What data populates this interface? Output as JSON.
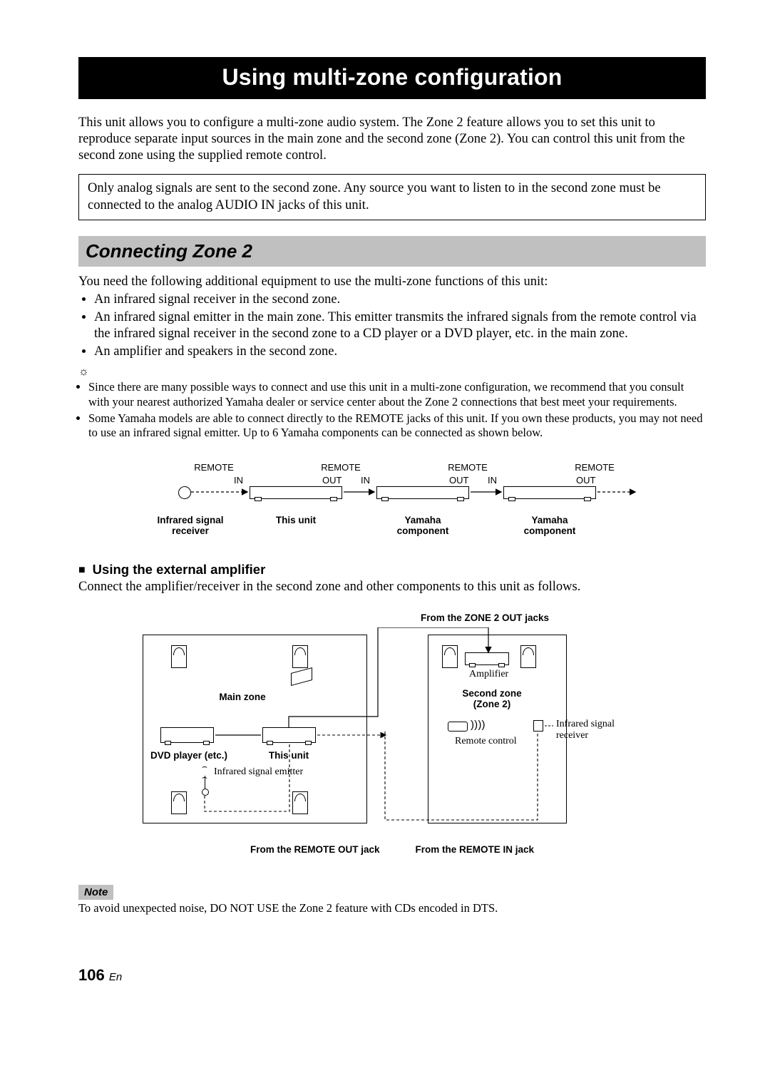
{
  "title": "Using multi-zone configuration",
  "intro": "This unit allows you to configure a multi-zone audio system. The Zone 2 feature allows you to set this unit to reproduce separate input sources in the main zone and the second zone (Zone 2). You can control this unit from the second zone using the supplied remote control.",
  "callout": "Only analog signals are sent to the second zone. Any source you want to listen to in the second zone must be connected to the analog AUDIO IN jacks of this unit.",
  "section_heading": "Connecting Zone 2",
  "equip_intro": "You need the following additional equipment to use the multi-zone functions of this unit:",
  "equip_bullets": [
    "An infrared signal receiver in the second zone.",
    "An infrared signal emitter in the main zone. This emitter transmits the infrared signals from the remote control via the infrared signal receiver in the second zone to a CD player or a DVD player, etc. in the main zone.",
    "An amplifier and speakers in the second zone."
  ],
  "tip_bullets": [
    "Since there are many possible ways to connect and use this unit in a multi-zone configuration, we recommend that you consult with your nearest authorized Yamaha dealer or service center about the Zone 2 connections that best meet your requirements.",
    "Some Yamaha models are able to connect directly to the REMOTE jacks of this unit. If you own these products, you may not need to use an infrared signal emitter. Up to 6 Yamaha components can be connected as shown below."
  ],
  "diagram1": {
    "remote": "REMOTE",
    "in": "IN",
    "out": "OUT",
    "captions": {
      "ir": "Infrared signal\nreceiver",
      "this_unit": "This unit",
      "comp": "Yamaha\ncomponent"
    }
  },
  "sub_heading": "Using the external amplifier",
  "sub_body": "Connect the amplifier/receiver in the second zone and other components to this unit as follows.",
  "diagram2": {
    "top_label": "From the ZONE 2 OUT jacks",
    "main_zone": "Main zone",
    "second_zone": "Second zone\n(Zone 2)",
    "amplifier": "Amplifier",
    "dvd": "DVD player (etc.)",
    "this_unit": "This unit",
    "emitter": "Infrared signal emitter",
    "remote_control": "Remote control",
    "ir_receiver": "Infrared signal receiver",
    "bottom_left": "From the REMOTE OUT jack",
    "bottom_right": "From the REMOTE IN jack"
  },
  "note_label": "Note",
  "note_body": "To avoid unexpected noise, DO NOT USE the Zone 2 feature with CDs encoded in DTS.",
  "page_number": "106",
  "page_lang": "En"
}
